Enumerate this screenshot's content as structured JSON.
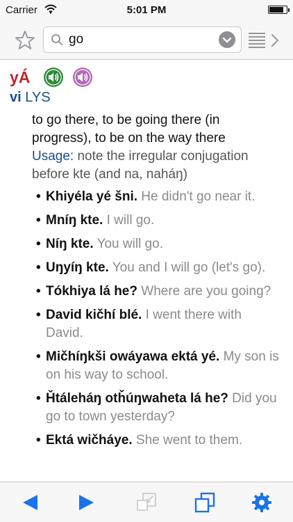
{
  "status_bar": {
    "carrier": "Carrier",
    "time": "5:01 PM",
    "battery_level": 0.85
  },
  "search": {
    "query": "go"
  },
  "entry": {
    "headword": "yÁ",
    "pos_abbr": "vi",
    "source": "LYS",
    "definition": "to go there, to be going there (in progress), to be on the way there",
    "usage_label": "Usage:",
    "usage_text": "note the irregular conjugation before kte (and na, naháŋ)",
    "examples": [
      {
        "term": "Khiyéla yé šni.",
        "translation": "He didn't go near it."
      },
      {
        "term": "Mníŋ kte.",
        "translation": "I will go."
      },
      {
        "term": "Níŋ kte.",
        "translation": "You will go."
      },
      {
        "term": "Uŋyíŋ kte.",
        "translation": "You and I will go (let's go)."
      },
      {
        "term": "Tókhiya lá he?",
        "translation": "Where are you going?"
      },
      {
        "term": "David kičhí blé.",
        "translation": "I went there with David."
      },
      {
        "term": "Mičhíŋkši owáyawa ektá yé.",
        "translation": "My son is on his way to school."
      },
      {
        "term": "Ȟtáleháŋ otȟúŋwaheta lá he?",
        "translation": "Did you go to town yesterday?"
      },
      {
        "term": "Ektá wičháye.",
        "translation": "She went to them."
      }
    ]
  },
  "colors": {
    "headword": "#c0262d",
    "pos": "#1a4d8c",
    "sound1": "#2e8b3a",
    "sound2": "#b06ab3",
    "accent": "#1a73e8",
    "translation": "#8a8a8f"
  },
  "icons": {
    "star": "star-icon",
    "search": "search-icon",
    "clear": "clear-icon",
    "list": "list-icon",
    "chevron": "chevron-right-icon",
    "back": "back-arrow-icon",
    "forward": "forward-arrow-icon",
    "shrink": "shrink-window-icon",
    "windows": "windows-icon",
    "settings": "gear-icon"
  }
}
